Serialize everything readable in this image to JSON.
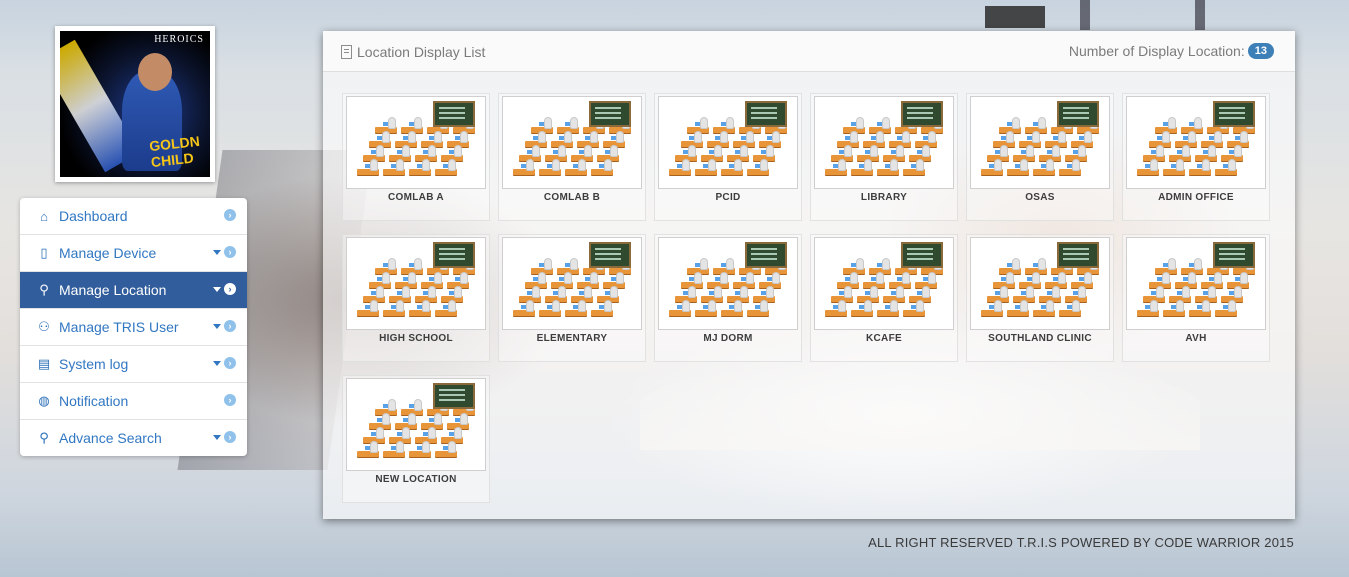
{
  "avatar": {
    "brand": "HEROICS",
    "jersey_text": "GOLDN CHILD"
  },
  "sidebar": {
    "items": [
      {
        "label": "Dashboard",
        "icon": "home-icon",
        "has_caret": false,
        "active": false
      },
      {
        "label": "Manage Device",
        "icon": "tablet-icon",
        "has_caret": true,
        "active": false
      },
      {
        "label": "Manage Location",
        "icon": "sitemap-icon",
        "has_caret": true,
        "active": true
      },
      {
        "label": "Manage TRIS User",
        "icon": "users-icon",
        "has_caret": true,
        "active": false
      },
      {
        "label": "System log",
        "icon": "book-icon",
        "has_caret": true,
        "active": false
      },
      {
        "label": "Notification",
        "icon": "globe-icon",
        "has_caret": false,
        "active": false
      },
      {
        "label": "Advance Search",
        "icon": "search-icon",
        "has_caret": true,
        "active": false
      }
    ]
  },
  "panel": {
    "title": "Location Display List",
    "count_label": "Number of Display Location:",
    "count": "13"
  },
  "locations": [
    "COMLAB A",
    "COMLAB B",
    "PCID",
    "LIBRARY",
    "OSAS",
    "ADMIN OFFICE",
    "HIGH SCHOOL",
    "ELEMENTARY",
    "MJ DORM",
    "KCAFE",
    "SOUTHLAND CLINIC",
    "AVH",
    "NEW LOCATION"
  ],
  "footer": {
    "text": "ALL RIGHT RESERVED T.R.I.S POWERED BY CODE WARRIOR 2015"
  },
  "colors": {
    "accent": "#315d9c",
    "link": "#3177c2",
    "badge": "#3d80b8"
  }
}
